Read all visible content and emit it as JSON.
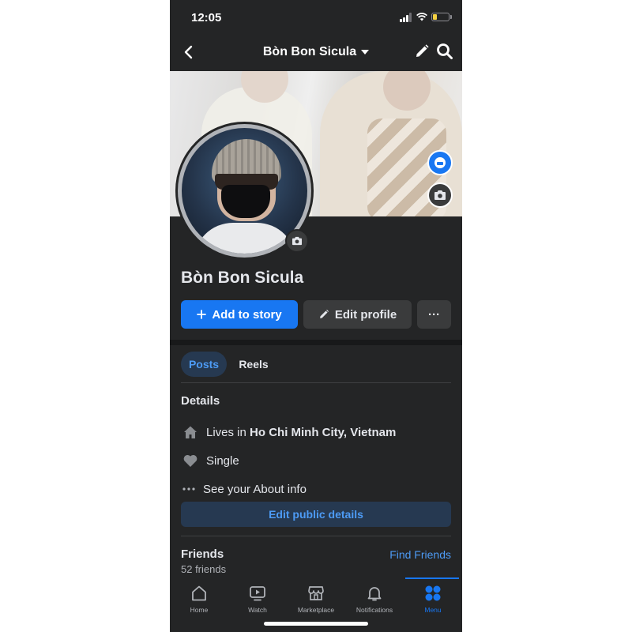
{
  "status_bar": {
    "time": "12:05",
    "battery_level": 0.2
  },
  "nav": {
    "title": "Bòn Bon Sicula",
    "icons": [
      "back-icon",
      "caret-down-icon",
      "pencil-icon",
      "search-icon"
    ]
  },
  "profile": {
    "name": "Bòn Bon Sicula",
    "add_story_label": "Add to story",
    "edit_profile_label": "Edit profile",
    "more_label": "···"
  },
  "tabs": {
    "posts": "Posts",
    "reels": "Reels"
  },
  "details": {
    "title": "Details",
    "lives_prefix": "Lives in",
    "lives_city": "Ho Chi Minh City, Vietnam",
    "relationship": "Single",
    "about": "See your About info",
    "edit_public_label": "Edit public details"
  },
  "friends": {
    "title": "Friends",
    "count": "52 friends",
    "find_label": "Find Friends"
  },
  "bottom_tabs": [
    {
      "label": "Home",
      "icon": "home-icon",
      "active": false
    },
    {
      "label": "Watch",
      "icon": "watch-icon",
      "active": false
    },
    {
      "label": "Marketplace",
      "icon": "marketplace-icon",
      "active": false
    },
    {
      "label": "Notifications",
      "icon": "bell-icon",
      "active": false
    },
    {
      "label": "Menu",
      "icon": "menu-grid-icon",
      "active": true
    }
  ],
  "colors": {
    "accent": "#1877f2",
    "background": "#242526",
    "secondary_button": "#3a3b3c",
    "tinted_button": "#263951"
  }
}
